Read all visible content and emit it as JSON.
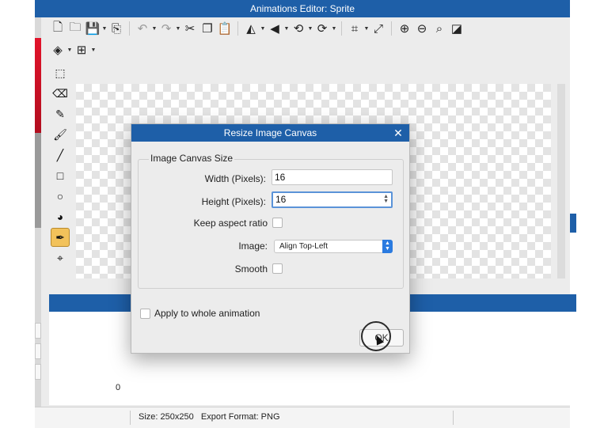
{
  "window": {
    "title": "Animations Editor: Sprite"
  },
  "toolbar": {
    "icons": [
      "new-file-icon",
      "open-folder-icon",
      "save-icon",
      "export-icon",
      "undo-icon",
      "redo-icon",
      "cut-icon",
      "copy-icon",
      "paste-icon",
      "flip-horizontal-icon",
      "flip-vertical-icon",
      "rotate-left-icon",
      "rotate-right-icon",
      "crop-icon",
      "resize-icon",
      "zoom-in-icon",
      "zoom-out-icon",
      "zoom-fit-icon",
      "invert-icon",
      "layers-icon",
      "grid-icon"
    ]
  },
  "tools": [
    "selection-icon",
    "eraser-icon",
    "pencil-icon",
    "brush-icon",
    "line-icon",
    "rectangle-icon",
    "ellipse-icon",
    "fill-bucket-icon",
    "eyedropper-icon",
    "center-point-icon"
  ],
  "active_tool": "eyedropper-icon",
  "timeline": {
    "zero_label": "0"
  },
  "status": {
    "text": "Size: 250x250   Export Format: PNG"
  },
  "dialog": {
    "title": "Resize Image Canvas",
    "close_symbol": "✕",
    "group_title": "Image Canvas Size",
    "width_label": "Width (Pixels):",
    "width_value": "16",
    "height_label": "Height (Pixels):",
    "height_value": "16",
    "keep_aspect_label": "Keep aspect ratio",
    "image_label": "Image:",
    "image_value": "Align Top-Left",
    "smooth_label": "Smooth",
    "apply_label": "Apply to whole animation",
    "ok_label": "OK"
  }
}
